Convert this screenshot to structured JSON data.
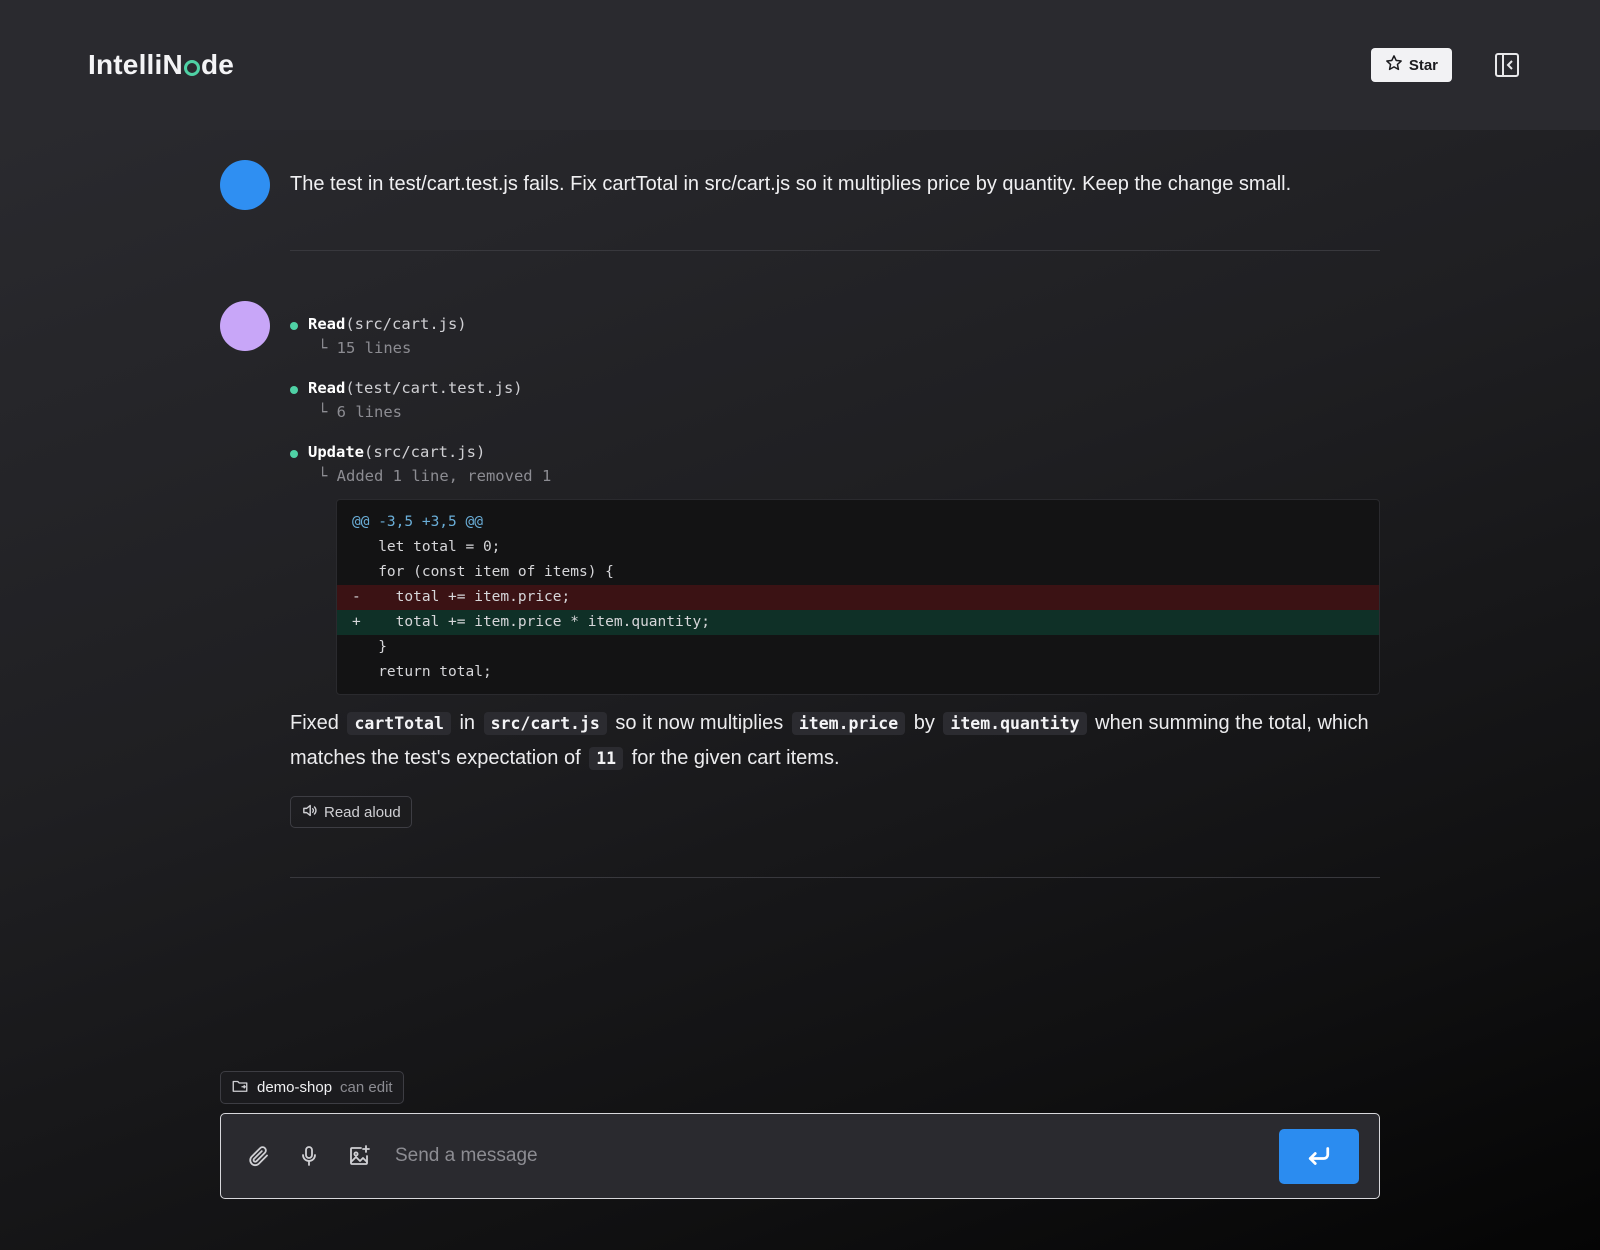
{
  "app": {
    "name_prefix": "IntelliN",
    "name_suffix": "de"
  },
  "header": {
    "star_label": "Star"
  },
  "user_message": {
    "text": "The test in test/cart.test.js fails. Fix cartTotal in src/cart.js so it multiplies price by quantity. Keep the change small."
  },
  "tools": [
    {
      "name": "Read",
      "arg": "(src/cart.js)",
      "result": "└ 15 lines"
    },
    {
      "name": "Read",
      "arg": "(test/cart.test.js)",
      "result": "└ 6 lines"
    },
    {
      "name": "Update",
      "arg": "(src/cart.js)",
      "result": "└ Added 1 line, removed 1"
    }
  ],
  "diff": {
    "hunk": "@@ -3,5 +3,5 @@",
    "lines": [
      "   let total = 0;",
      "   for (const item of items) {",
      "-    total += item.price;",
      "+    total += item.price * item.quantity;",
      "   }",
      "   return total;"
    ]
  },
  "answer": {
    "t1": "Fixed",
    "c1": "cartTotal",
    "t2": "in",
    "c2": "src/cart.js",
    "t3": "so it now multiplies",
    "c3": "item.price",
    "t4": "by",
    "c4": "item.quantity",
    "t5": "when summing the total, which matches the test's expectation of",
    "c5": "11",
    "t6": "for the given cart items."
  },
  "read_aloud_label": "Read aloud",
  "context": {
    "name": "demo-shop",
    "permission": "can edit"
  },
  "composer": {
    "placeholder": "Send a message"
  },
  "colors": {
    "accent": "#2b8cf0",
    "user_avatar": "#2f8ff2",
    "assistant_avatar": "#c8a6f8",
    "tool_dot": "#4fd1a5"
  }
}
